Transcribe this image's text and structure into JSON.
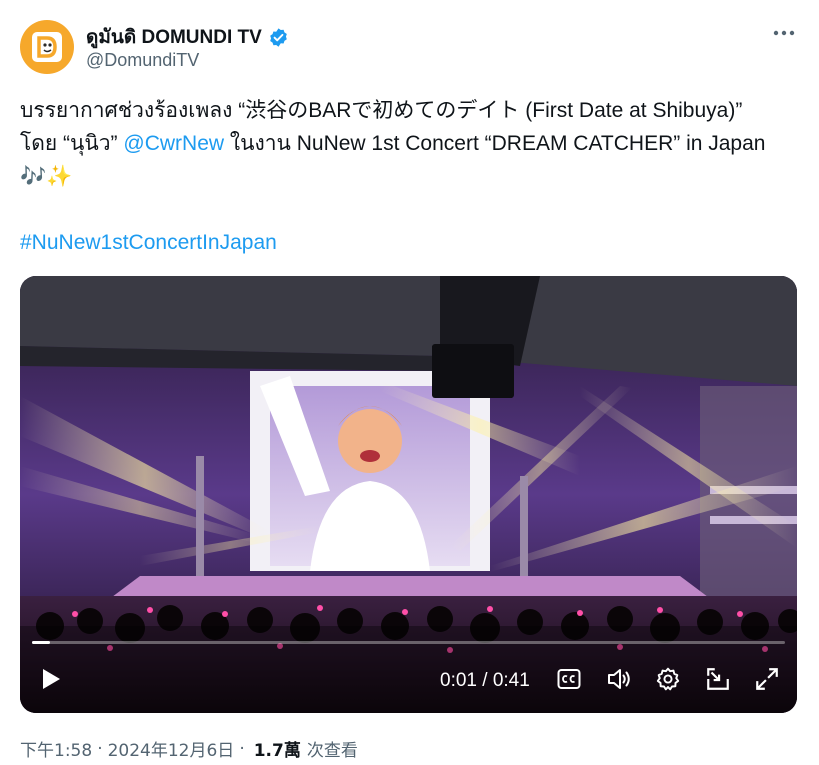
{
  "author": {
    "display_name": "ดูมันดิ DOMUNDI TV",
    "handle": "@DomundiTV",
    "avatar_icon": "domundi-logo",
    "avatar_color": "#f6a82b",
    "verified_color": "#1d9bf0"
  },
  "tweet": {
    "text_1": "บรรยากาศช่วงร้องเพลง “渋谷のBARで初めてのデイト (First Date at Shibuya)” โดย “นุนิว” ",
    "mention": "@CwrNew",
    "text_2": " ในงาน NuNew 1st Concert “DREAM CATCHER” in Japan 🎶✨",
    "hashtag": "#NuNew1stConcertInJapan",
    "link_color": "#1d9bf0"
  },
  "video": {
    "current_time": "0:01",
    "separator": " / ",
    "duration": "0:41",
    "progress_fraction": 0.024,
    "controls": [
      "play-icon",
      "closed-captions-icon",
      "volume-icon",
      "settings-icon",
      "minimize-icon",
      "fullscreen-icon"
    ]
  },
  "meta": {
    "time": "下午1:58",
    "dot": "·",
    "date": "2024年12月6日",
    "views_count": "1.7萬",
    "views_label": "次查看"
  },
  "more_icon": "more-horizontal-icon"
}
